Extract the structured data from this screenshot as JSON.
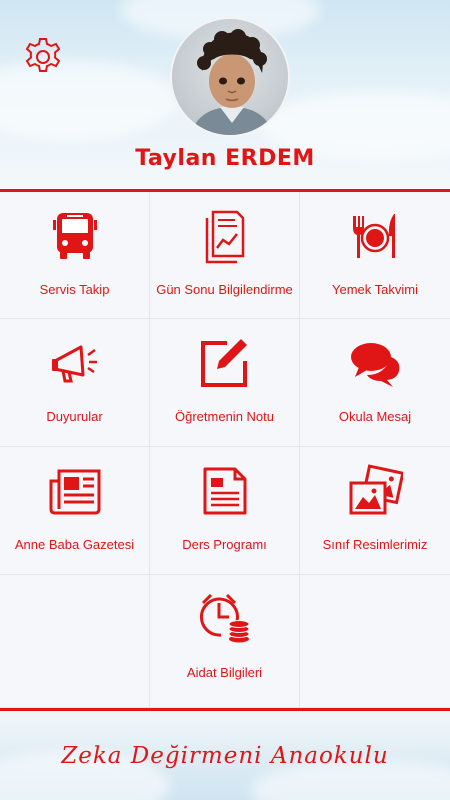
{
  "profile": {
    "name": "Taylan ERDEM",
    "settings_icon": "gear-icon"
  },
  "menu": [
    {
      "label": "Servis Takip",
      "icon": "bus-icon"
    },
    {
      "label": "Gün Sonu Bilgilendirme",
      "icon": "daily-report-icon"
    },
    {
      "label": "Yemek Takvimi",
      "icon": "meal-icon"
    },
    {
      "label": "Duyurular",
      "icon": "megaphone-icon"
    },
    {
      "label": "Öğretmenin Notu",
      "icon": "edit-note-icon"
    },
    {
      "label": "Okula Mesaj",
      "icon": "chat-bubbles-icon"
    },
    {
      "label": "Anne Baba Gazetesi",
      "icon": "newspaper-icon"
    },
    {
      "label": "Ders Programı",
      "icon": "schedule-document-icon"
    },
    {
      "label": "Sınıf Resimlerimiz",
      "icon": "photos-icon"
    },
    {
      "label": "Aidat Bilgileri",
      "icon": "clock-coins-icon"
    }
  ],
  "footer": {
    "school_name": "Zeka Değirmeni Anaokulu"
  },
  "colors": {
    "accent": "#e01616",
    "sky": "#cfe6f3",
    "grid_background": "#f5f7fa"
  }
}
